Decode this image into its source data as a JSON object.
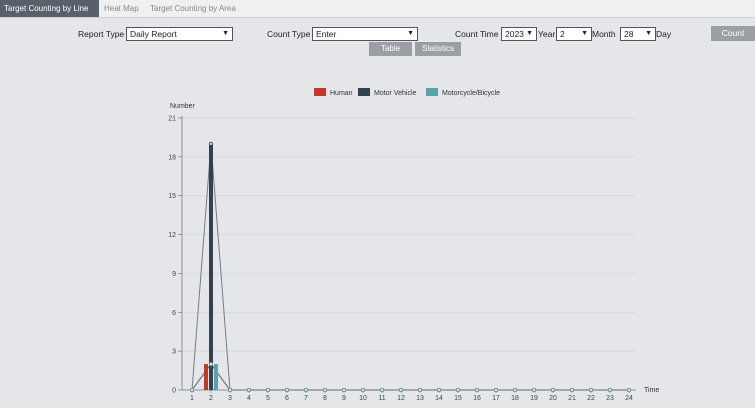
{
  "tabs": [
    {
      "label": "Target Counting by Line",
      "active": true
    },
    {
      "label": "Heat Map",
      "active": false
    },
    {
      "label": "Target Counting by Area",
      "active": false
    }
  ],
  "filters": {
    "report_type_label": "Report Type",
    "report_type_value": "Daily Report",
    "count_type_label": "Count Type",
    "count_type_value": "Enter",
    "count_time_label": "Count Time",
    "year_value": "2023",
    "year_label": "Year",
    "month_value": "2",
    "month_label": "Month",
    "day_value": "28",
    "day_label": "Day",
    "count_button": "Count"
  },
  "view_buttons": {
    "table": "Table",
    "statistics": "Statistics"
  },
  "colors": {
    "human": "#c0392b",
    "motor_vehicle": "#34424f",
    "motorcycle_bicycle": "#5ba2a8"
  },
  "chart_data": {
    "type": "bar",
    "ylabel": "Number",
    "xlabel": "Time",
    "ylim": [
      0,
      21
    ],
    "yticks": [
      0,
      3,
      6,
      9,
      12,
      15,
      18,
      21
    ],
    "categories": [
      "1",
      "2",
      "3",
      "4",
      "5",
      "6",
      "7",
      "8",
      "9",
      "10",
      "11",
      "12",
      "13",
      "14",
      "15",
      "16",
      "17",
      "18",
      "19",
      "20",
      "21",
      "22",
      "23",
      "24"
    ],
    "legend_position": "top-center",
    "series": [
      {
        "name": "Human",
        "color": "#c0392b",
        "values": [
          0,
          2,
          0,
          0,
          0,
          0,
          0,
          0,
          0,
          0,
          0,
          0,
          0,
          0,
          0,
          0,
          0,
          0,
          0,
          0,
          0,
          0,
          0,
          0
        ]
      },
      {
        "name": "Motor Vehicle",
        "color": "#34424f",
        "values": [
          0,
          19,
          0,
          0,
          0,
          0,
          0,
          0,
          0,
          0,
          0,
          0,
          0,
          0,
          0,
          0,
          0,
          0,
          0,
          0,
          0,
          0,
          0,
          0
        ]
      },
      {
        "name": "Motorcycle/Bicycle",
        "color": "#5ba2a8",
        "values": [
          0,
          2,
          0,
          0,
          0,
          0,
          0,
          0,
          0,
          0,
          0,
          0,
          0,
          0,
          0,
          0,
          0,
          0,
          0,
          0,
          0,
          0,
          0,
          0
        ]
      }
    ]
  }
}
